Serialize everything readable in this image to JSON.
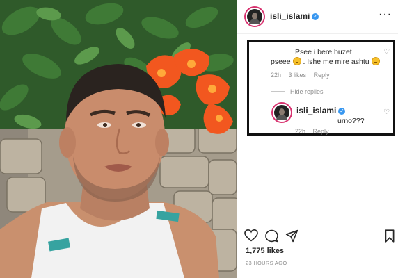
{
  "post": {
    "author": "isli_islami",
    "likes": "1,775 likes",
    "timestamp": "23 HOURS AGO"
  },
  "comment": {
    "line1": "Psee i bere buzet",
    "line2_a": "pseee",
    "line2_b": ". Ishe me mire ashtu",
    "time": "22h",
    "likes": "3 likes",
    "reply_label": "Reply",
    "hide_replies": "Hide replies"
  },
  "reply": {
    "author": "isli_islami",
    "text": "urno???",
    "time": "22h",
    "reply_label": "Reply"
  },
  "icons": {
    "more": "more-options-icon",
    "like": "heart-icon",
    "comment": "comment-icon",
    "share": "share-icon",
    "save": "bookmark-icon",
    "verified": "verified-badge-icon"
  },
  "colors": {
    "verified_blue": "#3897f0",
    "story_ring": "#d8326f",
    "muted_text": "#8e8e8e",
    "highlight_border": "#111111"
  }
}
